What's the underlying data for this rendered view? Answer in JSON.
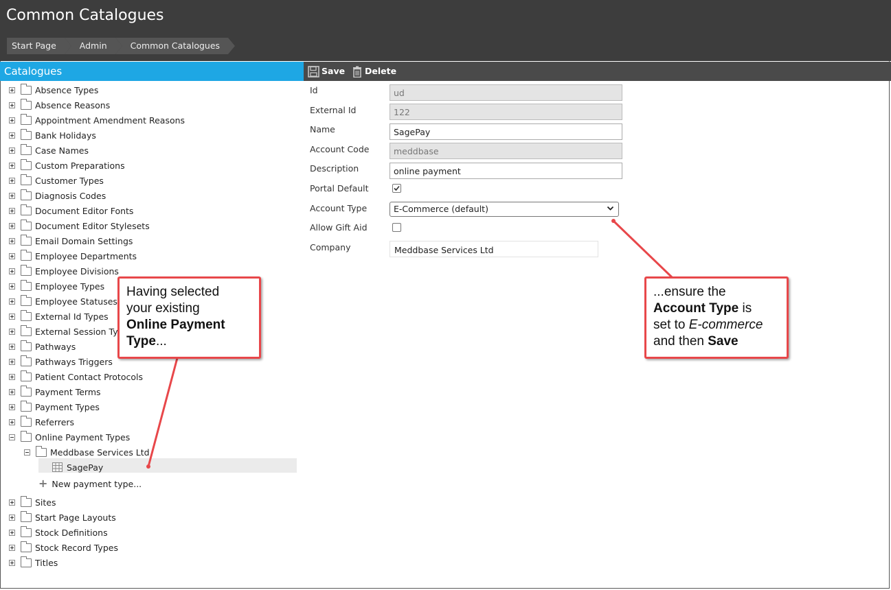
{
  "header": {
    "title": "Common Catalogues",
    "breadcrumbs": [
      "Start Page",
      "Admin",
      "Common Catalogues"
    ]
  },
  "left_panel": {
    "title": "Catalogues",
    "items_top": [
      "Absence Types",
      "Absence Reasons",
      "Appointment Amendment Reasons",
      "Bank Holidays",
      "Case Names",
      "Custom Preparations",
      "Customer Types",
      "Diagnosis Codes",
      "Document Editor Fonts",
      "Document Editor Stylesets",
      "Email Domain Settings",
      "Employee Departments",
      "Employee Divisions",
      "Employee Types",
      "Employee Statuses",
      "External Id Types",
      "External Session Types",
      "Pathways",
      "Pathways Triggers",
      "Patient Contact Protocols",
      "Payment Terms",
      "Payment Types",
      "Referrers"
    ],
    "expanded_item": "Online Payment Types",
    "sub_folder": "Meddbase Services Ltd",
    "selected_leaf": "SagePay",
    "new_item": "New payment type...",
    "items_bottom": [
      "Sites",
      "Start Page Layouts",
      "Stock Definitions",
      "Stock Record Types",
      "Titles"
    ]
  },
  "toolbar": {
    "save_label": "Save",
    "delete_label": "Delete"
  },
  "form": {
    "id_label": "Id",
    "id_value": "ud",
    "external_id_label": "External Id",
    "external_id_value": "122",
    "name_label": "Name",
    "name_value": "SagePay",
    "account_code_label": "Account Code",
    "account_code_value": "meddbase",
    "description_label": "Description",
    "description_value": "online payment",
    "portal_default_label": "Portal Default",
    "portal_default_checked": true,
    "account_type_label": "Account Type",
    "account_type_value": "E-Commerce (default)",
    "allow_gift_aid_label": "Allow Gift Aid",
    "allow_gift_aid_checked": false,
    "company_label": "Company",
    "company_value": "Meddbase Services Ltd"
  },
  "callouts": {
    "left": {
      "line1": "Having selected",
      "line2": "your existing",
      "bold": "Online Payment",
      "bold2": "Type",
      "tail": "..."
    },
    "right": {
      "line1": "...ensure the",
      "bold1": "Account Type",
      "text1": " is",
      "text2": "set to ",
      "italic": "E-commerce",
      "text3": "and then ",
      "bold2": "Save"
    }
  },
  "colors": {
    "header_bg": "#3d3d3d",
    "accent": "#1ea7e4",
    "callout_border": "#e8474a"
  }
}
